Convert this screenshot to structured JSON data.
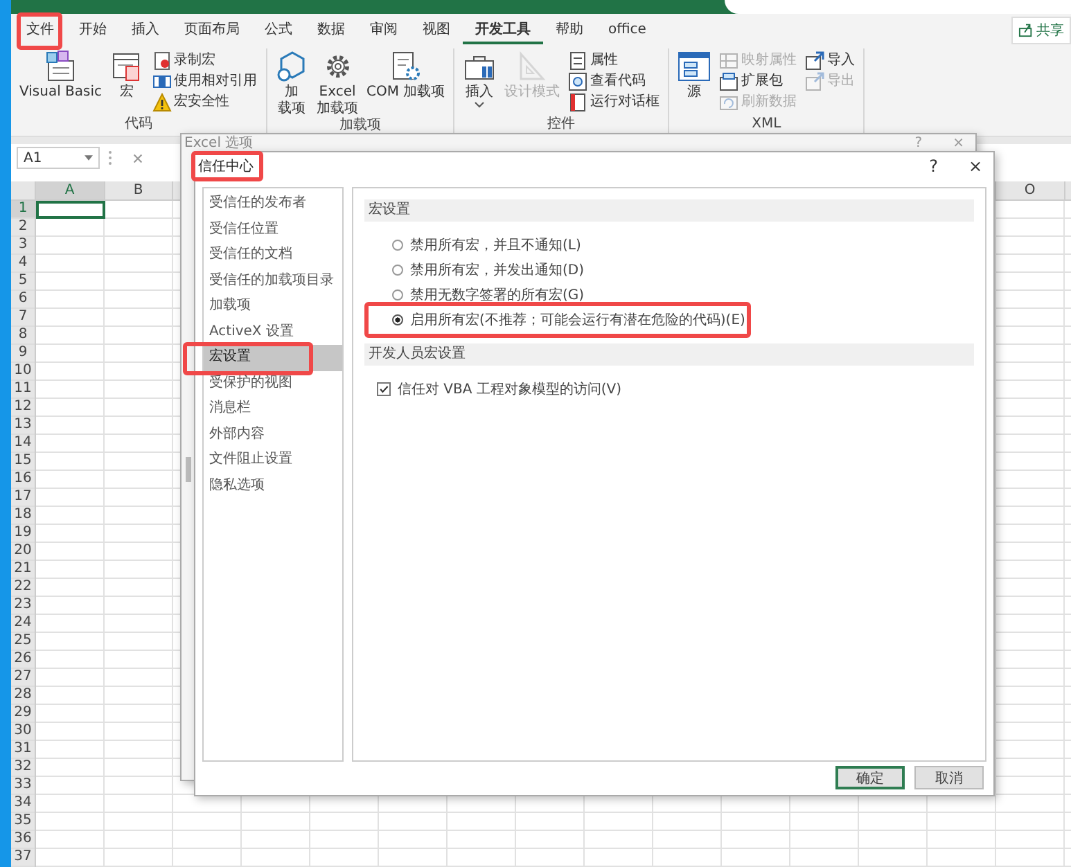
{
  "tabs": [
    {
      "label": "文件",
      "selected": false,
      "highlighted": true
    },
    {
      "label": "开始",
      "selected": false,
      "highlighted": false
    },
    {
      "label": "插入",
      "selected": false,
      "highlighted": false
    },
    {
      "label": "页面布局",
      "selected": false,
      "highlighted": false
    },
    {
      "label": "公式",
      "selected": false,
      "highlighted": false
    },
    {
      "label": "数据",
      "selected": false,
      "highlighted": false
    },
    {
      "label": "审阅",
      "selected": false,
      "highlighted": false
    },
    {
      "label": "视图",
      "selected": false,
      "highlighted": false
    },
    {
      "label": "开发工具",
      "selected": true,
      "highlighted": false
    },
    {
      "label": "帮助",
      "selected": false,
      "highlighted": false
    },
    {
      "label": "office",
      "selected": false,
      "highlighted": false
    }
  ],
  "share_button": {
    "label": "共享"
  },
  "ribbon_groups": [
    {
      "label": "代码",
      "items": [
        {
          "kind": "large",
          "lines": [
            "Visual Basic"
          ],
          "disabled": false,
          "dropdown": false
        },
        {
          "kind": "large",
          "lines": [
            "宏"
          ],
          "disabled": false,
          "dropdown": false
        },
        {
          "kind": "stack",
          "items": [
            {
              "label": "录制宏",
              "disabled": false
            },
            {
              "label": "使用相对引用",
              "disabled": false
            },
            {
              "label": "宏安全性",
              "disabled": false
            }
          ]
        }
      ]
    },
    {
      "label": "加载项",
      "items": [
        {
          "kind": "large",
          "lines": [
            "加",
            "载项"
          ],
          "disabled": false,
          "dropdown": false
        },
        {
          "kind": "large",
          "lines": [
            "Excel",
            "加载项"
          ],
          "disabled": false,
          "dropdown": false
        },
        {
          "kind": "large",
          "lines": [
            "COM 加载项"
          ],
          "disabled": false,
          "dropdown": false
        }
      ]
    },
    {
      "label": "控件",
      "items": [
        {
          "kind": "large",
          "lines": [
            "插入"
          ],
          "disabled": false,
          "dropdown": true
        },
        {
          "kind": "large",
          "lines": [
            "设计模式"
          ],
          "disabled": true,
          "dropdown": false
        },
        {
          "kind": "stack",
          "items": [
            {
              "label": "属性",
              "disabled": false
            },
            {
              "label": "查看代码",
              "disabled": false
            },
            {
              "label": "运行对话框",
              "disabled": false
            }
          ]
        }
      ]
    },
    {
      "label": "XML",
      "items": [
        {
          "kind": "large",
          "lines": [
            "源"
          ],
          "disabled": false,
          "dropdown": false
        },
        {
          "kind": "stack",
          "items": [
            {
              "label": "映射属性",
              "disabled": true
            },
            {
              "label": "扩展包",
              "disabled": false
            },
            {
              "label": "刷新数据",
              "disabled": true
            }
          ]
        },
        {
          "kind": "stack",
          "items": [
            {
              "label": "导入",
              "disabled": false
            },
            {
              "label": "导出",
              "disabled": true
            }
          ]
        }
      ]
    }
  ],
  "name_box": {
    "value": "A1"
  },
  "sheet": {
    "columns": [
      {
        "label": "A",
        "selected": true
      },
      {
        "label": "B",
        "selected": false
      },
      {
        "label": "O",
        "selected": false
      }
    ],
    "rows": [
      {
        "label": "1",
        "selected": true
      },
      {
        "label": "2",
        "selected": false
      },
      {
        "label": "3",
        "selected": false
      },
      {
        "label": "4",
        "selected": false
      },
      {
        "label": "5",
        "selected": false
      },
      {
        "label": "6",
        "selected": false
      },
      {
        "label": "7",
        "selected": false
      },
      {
        "label": "8",
        "selected": false
      },
      {
        "label": "9",
        "selected": false
      },
      {
        "label": "10",
        "selected": false
      },
      {
        "label": "11",
        "selected": false
      },
      {
        "label": "12",
        "selected": false
      },
      {
        "label": "13",
        "selected": false
      },
      {
        "label": "14",
        "selected": false
      },
      {
        "label": "15",
        "selected": false
      },
      {
        "label": "16",
        "selected": false
      },
      {
        "label": "17",
        "selected": false
      },
      {
        "label": "18",
        "selected": false
      },
      {
        "label": "19",
        "selected": false
      },
      {
        "label": "20",
        "selected": false
      },
      {
        "label": "21",
        "selected": false
      },
      {
        "label": "22",
        "selected": false
      },
      {
        "label": "23",
        "selected": false
      },
      {
        "label": "24",
        "selected": false
      },
      {
        "label": "25",
        "selected": false
      },
      {
        "label": "26",
        "selected": false
      },
      {
        "label": "27",
        "selected": false
      },
      {
        "label": "28",
        "selected": false
      },
      {
        "label": "29",
        "selected": false
      },
      {
        "label": "30",
        "selected": false
      },
      {
        "label": "31",
        "selected": false
      },
      {
        "label": "32",
        "selected": false
      },
      {
        "label": "33",
        "selected": false
      },
      {
        "label": "34",
        "selected": false
      },
      {
        "label": "35",
        "selected": false
      },
      {
        "label": "36",
        "selected": false
      },
      {
        "label": "37",
        "selected": false
      }
    ]
  },
  "options_dialog": {
    "title": "Excel 选项",
    "help": "?",
    "close": "×"
  },
  "trust_center_dialog": {
    "title": "信任中心",
    "highlighted": true,
    "help": "?",
    "close": "×",
    "nav": [
      {
        "label": "受信任的发布者",
        "selected": false,
        "highlighted": false
      },
      {
        "label": "受信任位置",
        "selected": false,
        "highlighted": false
      },
      {
        "label": "受信任的文档",
        "selected": false,
        "highlighted": false
      },
      {
        "label": "受信任的加载项目录",
        "selected": false,
        "highlighted": false
      },
      {
        "label": "加载项",
        "selected": false,
        "highlighted": false
      },
      {
        "label": "ActiveX 设置",
        "selected": false,
        "highlighted": false
      },
      {
        "label": "宏设置",
        "selected": true,
        "highlighted": true
      },
      {
        "label": "受保护的视图",
        "selected": false,
        "highlighted": false
      },
      {
        "label": "消息栏",
        "selected": false,
        "highlighted": false
      },
      {
        "label": "外部内容",
        "selected": false,
        "highlighted": false
      },
      {
        "label": "文件阻止设置",
        "selected": false,
        "highlighted": false
      },
      {
        "label": "隐私选项",
        "selected": false,
        "highlighted": false
      }
    ],
    "sections": [
      {
        "kind": "radio",
        "header": "宏设置",
        "options": [
          {
            "label": "禁用所有宏，并且不通知(L)",
            "selected": false,
            "highlighted": false
          },
          {
            "label": "禁用所有宏，并发出通知(D)",
            "selected": false,
            "highlighted": false
          },
          {
            "label": "禁用无数字签署的所有宏(G)",
            "selected": false,
            "highlighted": false
          },
          {
            "label": "启用所有宏(不推荐；可能会运行有潜在危险的代码)(E)",
            "selected": true,
            "highlighted": true
          }
        ]
      },
      {
        "kind": "checkbox",
        "header": "开发人员宏设置",
        "options": [
          {
            "label": "信任对 VBA 工程对象模型的访问(V)",
            "checked": true,
            "highlighted": false
          }
        ]
      }
    ],
    "buttons": [
      {
        "label": "确定",
        "default": true
      },
      {
        "label": "取消",
        "default": false
      }
    ]
  }
}
